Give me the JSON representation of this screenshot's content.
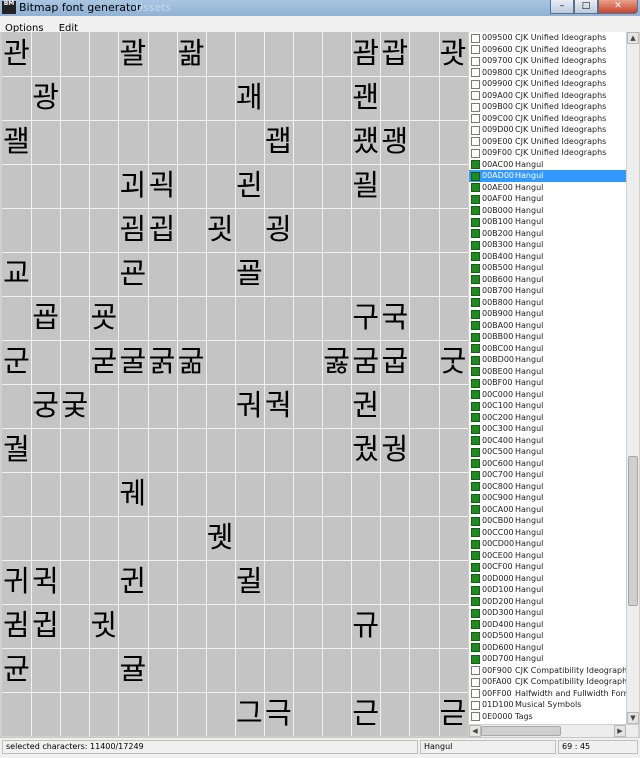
{
  "window": {
    "title": "Bitmap font generator",
    "icon_text": "BM",
    "ghost_title": "Ussets"
  },
  "window_buttons": {
    "minimize": "–",
    "maximize": "□",
    "close": "✕"
  },
  "menu": {
    "items": [
      "Options",
      "Edit"
    ]
  },
  "glyph_grid": {
    "rows": [
      [
        "관",
        "",
        "",
        "",
        "괄",
        "",
        "괆",
        "",
        "",
        "",
        "",
        "",
        "괌",
        "괍",
        "",
        "괏"
      ],
      [
        "",
        "광",
        "",
        "",
        "",
        "",
        "",
        "",
        "괘",
        "",
        "",
        "",
        "괜",
        "",
        "",
        ""
      ],
      [
        "괠",
        "",
        "",
        "",
        "",
        "",
        "",
        "",
        "",
        "괩",
        "",
        "",
        "괬",
        "괭",
        "",
        ""
      ],
      [
        "",
        "",
        "",
        "",
        "괴",
        "괵",
        "",
        "",
        "괸",
        "",
        "",
        "",
        "괼",
        "",
        "",
        ""
      ],
      [
        "",
        "",
        "",
        "",
        "굄",
        "굅",
        "",
        "굇",
        "",
        "굉",
        "",
        "",
        "",
        "",
        "",
        ""
      ],
      [
        "교",
        "",
        "",
        "",
        "굔",
        "",
        "",
        "",
        "굘",
        "",
        "",
        "",
        "",
        "",
        "",
        ""
      ],
      [
        "",
        "굡",
        "",
        "굣",
        "",
        "",
        "",
        "",
        "",
        "",
        "",
        "",
        "구",
        "국",
        "",
        ""
      ],
      [
        "군",
        "",
        "",
        "굳",
        "굴",
        "굵",
        "굶",
        "",
        "",
        "",
        "",
        "굻",
        "굼",
        "굽",
        "",
        "굿"
      ],
      [
        "",
        "궁",
        "궂",
        "",
        "",
        "",
        "",
        "",
        "궈",
        "궉",
        "",
        "",
        "권",
        "",
        "",
        ""
      ],
      [
        "궐",
        "",
        "",
        "",
        "",
        "",
        "",
        "",
        "",
        "",
        "",
        "",
        "궜",
        "궝",
        "",
        ""
      ],
      [
        "",
        "",
        "",
        "",
        "궤",
        "",
        "",
        "",
        "",
        "",
        "",
        "",
        "",
        "",
        "",
        ""
      ],
      [
        "",
        "",
        "",
        "",
        "",
        "",
        "",
        "궷",
        "",
        "",
        "",
        "",
        "",
        "",
        "",
        ""
      ],
      [
        "귀",
        "귁",
        "",
        "",
        "귄",
        "",
        "",
        "",
        "귈",
        "",
        "",
        "",
        "",
        "",
        "",
        ""
      ],
      [
        "귐",
        "귑",
        "",
        "귓",
        "",
        "",
        "",
        "",
        "",
        "",
        "",
        "",
        "규",
        "",
        "",
        ""
      ],
      [
        "균",
        "",
        "",
        "",
        "귤",
        "",
        "",
        "",
        "",
        "",
        "",
        "",
        "",
        "",
        "",
        ""
      ],
      [
        "",
        "",
        "",
        "",
        "",
        "",
        "",
        "",
        "그",
        "극",
        "",
        "",
        "근",
        "",
        "",
        "귿"
      ]
    ]
  },
  "unicode_ranges": [
    {
      "code": "009500",
      "name": "CJK Unified Ideographs",
      "checked": false,
      "selected": false
    },
    {
      "code": "009600",
      "name": "CJK Unified Ideographs",
      "checked": false,
      "selected": false
    },
    {
      "code": "009700",
      "name": "CJK Unified Ideographs",
      "checked": false,
      "selected": false
    },
    {
      "code": "009800",
      "name": "CJK Unified Ideographs",
      "checked": false,
      "selected": false
    },
    {
      "code": "009900",
      "name": "CJK Unified Ideographs",
      "checked": false,
      "selected": false
    },
    {
      "code": "009A00",
      "name": "CJK Unified Ideographs",
      "checked": false,
      "selected": false
    },
    {
      "code": "009B00",
      "name": "CJK Unified Ideographs",
      "checked": false,
      "selected": false
    },
    {
      "code": "009C00",
      "name": "CJK Unified Ideographs",
      "checked": false,
      "selected": false
    },
    {
      "code": "009D00",
      "name": "CJK Unified Ideographs",
      "checked": false,
      "selected": false
    },
    {
      "code": "009E00",
      "name": "CJK Unified Ideographs",
      "checked": false,
      "selected": false
    },
    {
      "code": "009F00",
      "name": "CJK Unified Ideographs",
      "checked": false,
      "selected": false
    },
    {
      "code": "00AC00",
      "name": "Hangul",
      "checked": true,
      "selected": false
    },
    {
      "code": "00AD00",
      "name": "Hangul",
      "checked": true,
      "selected": true
    },
    {
      "code": "00AE00",
      "name": "Hangul",
      "checked": true,
      "selected": false
    },
    {
      "code": "00AF00",
      "name": "Hangul",
      "checked": true,
      "selected": false
    },
    {
      "code": "00B000",
      "name": "Hangul",
      "checked": true,
      "selected": false
    },
    {
      "code": "00B100",
      "name": "Hangul",
      "checked": true,
      "selected": false
    },
    {
      "code": "00B200",
      "name": "Hangul",
      "checked": true,
      "selected": false
    },
    {
      "code": "00B300",
      "name": "Hangul",
      "checked": true,
      "selected": false
    },
    {
      "code": "00B400",
      "name": "Hangul",
      "checked": true,
      "selected": false
    },
    {
      "code": "00B500",
      "name": "Hangul",
      "checked": true,
      "selected": false
    },
    {
      "code": "00B600",
      "name": "Hangul",
      "checked": true,
      "selected": false
    },
    {
      "code": "00B700",
      "name": "Hangul",
      "checked": true,
      "selected": false
    },
    {
      "code": "00B800",
      "name": "Hangul",
      "checked": true,
      "selected": false
    },
    {
      "code": "00B900",
      "name": "Hangul",
      "checked": true,
      "selected": false
    },
    {
      "code": "00BA00",
      "name": "Hangul",
      "checked": true,
      "selected": false
    },
    {
      "code": "00BB00",
      "name": "Hangul",
      "checked": true,
      "selected": false
    },
    {
      "code": "00BC00",
      "name": "Hangul",
      "checked": true,
      "selected": false
    },
    {
      "code": "00BD00",
      "name": "Hangul",
      "checked": true,
      "selected": false
    },
    {
      "code": "00BE00",
      "name": "Hangul",
      "checked": true,
      "selected": false
    },
    {
      "code": "00BF00",
      "name": "Hangul",
      "checked": true,
      "selected": false
    },
    {
      "code": "00C000",
      "name": "Hangul",
      "checked": true,
      "selected": false
    },
    {
      "code": "00C100",
      "name": "Hangul",
      "checked": true,
      "selected": false
    },
    {
      "code": "00C200",
      "name": "Hangul",
      "checked": true,
      "selected": false
    },
    {
      "code": "00C300",
      "name": "Hangul",
      "checked": true,
      "selected": false
    },
    {
      "code": "00C400",
      "name": "Hangul",
      "checked": true,
      "selected": false
    },
    {
      "code": "00C500",
      "name": "Hangul",
      "checked": true,
      "selected": false
    },
    {
      "code": "00C600",
      "name": "Hangul",
      "checked": true,
      "selected": false
    },
    {
      "code": "00C700",
      "name": "Hangul",
      "checked": true,
      "selected": false
    },
    {
      "code": "00C800",
      "name": "Hangul",
      "checked": true,
      "selected": false
    },
    {
      "code": "00C900",
      "name": "Hangul",
      "checked": true,
      "selected": false
    },
    {
      "code": "00CA00",
      "name": "Hangul",
      "checked": true,
      "selected": false
    },
    {
      "code": "00CB00",
      "name": "Hangul",
      "checked": true,
      "selected": false
    },
    {
      "code": "00CC00",
      "name": "Hangul",
      "checked": true,
      "selected": false
    },
    {
      "code": "00CD00",
      "name": "Hangul",
      "checked": true,
      "selected": false
    },
    {
      "code": "00CE00",
      "name": "Hangul",
      "checked": true,
      "selected": false
    },
    {
      "code": "00CF00",
      "name": "Hangul",
      "checked": true,
      "selected": false
    },
    {
      "code": "00D000",
      "name": "Hangul",
      "checked": true,
      "selected": false
    },
    {
      "code": "00D100",
      "name": "Hangul",
      "checked": true,
      "selected": false
    },
    {
      "code": "00D200",
      "name": "Hangul",
      "checked": true,
      "selected": false
    },
    {
      "code": "00D300",
      "name": "Hangul",
      "checked": true,
      "selected": false
    },
    {
      "code": "00D400",
      "name": "Hangul",
      "checked": true,
      "selected": false
    },
    {
      "code": "00D500",
      "name": "Hangul",
      "checked": true,
      "selected": false
    },
    {
      "code": "00D600",
      "name": "Hangul",
      "checked": true,
      "selected": false
    },
    {
      "code": "00D700",
      "name": "Hangul",
      "checked": true,
      "selected": false
    },
    {
      "code": "00F900",
      "name": "CJK Compatibility Ideographs",
      "checked": false,
      "selected": false
    },
    {
      "code": "00FA00",
      "name": "CJK Compatibility Ideographs",
      "checked": false,
      "selected": false
    },
    {
      "code": "00FF00",
      "name": "Halfwidth and Fullwidth Forms",
      "checked": false,
      "selected": false
    },
    {
      "code": "01D100",
      "name": "Musical Symbols",
      "checked": false,
      "selected": false
    },
    {
      "code": "0E0000",
      "name": "Tags",
      "checked": false,
      "selected": false
    }
  ],
  "status": {
    "selected_characters": "selected characters: 11400/17249",
    "range_name": "Hangul",
    "position": "69 : 45"
  },
  "colors": {
    "checked": "#1f8a1f",
    "selection": "#3399ff",
    "grid_background": "#c4c4c4"
  },
  "icons": {
    "checkbox": "checkbox-icon"
  }
}
